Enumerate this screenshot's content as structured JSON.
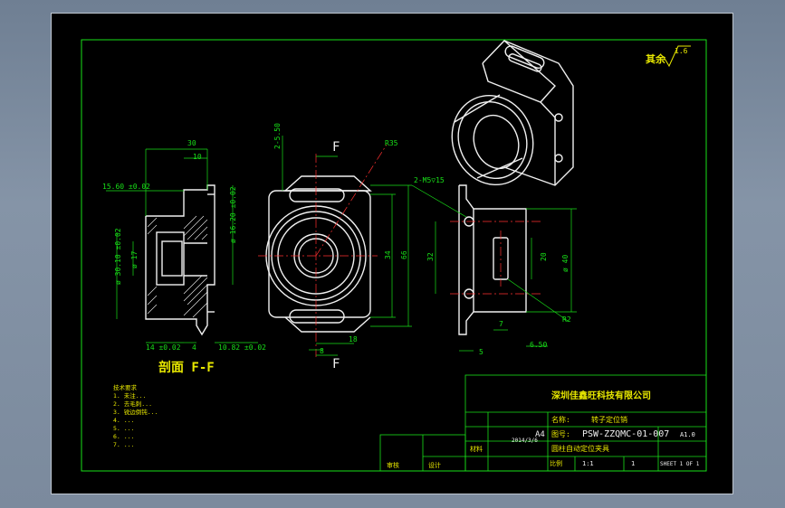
{
  "dimensions": {
    "d30": "30",
    "d10": "10",
    "d5_60": "15.60 ±0.02",
    "d16_20": "ø 16.20 ±0.02",
    "d30_10": "ø 30.10 ±0.02",
    "d17": "ø 17",
    "d14": "14 ±0.02",
    "d4": "4",
    "d10_82": "10.82 ±0.02",
    "d2_5_50": "2-5.50",
    "r35": "R35",
    "d34": "34",
    "d66": "66",
    "d18": "18",
    "d8": "8",
    "d2_m5": "2-M5▽15",
    "d32": "32",
    "d20": "20",
    "d40": "ø 40",
    "r2": "R2",
    "d7": "7",
    "d5": "5",
    "d6_50": "6.50",
    "section_f_top": "F",
    "section_f_bottom": "F"
  },
  "section_label": "剖面 F-F",
  "roughness": {
    "label": "其余",
    "value": "1.6"
  },
  "notes": [
    "技术要求",
    "1. 未注...",
    "2. 去毛刺...",
    "3. 锐边倒钝...",
    "4. ...",
    "5. ...",
    "6. ...",
    "7. ..."
  ],
  "title_block": {
    "company": "深圳佳鑫旺科技有限公司",
    "part_name_label": "名称:",
    "part_name": "转子定位销",
    "drawing_no_label": "图号:",
    "drawing_no": "PSW-ZZQMC-01-007",
    "size": "A4",
    "version": "A1.0",
    "material_label": "材料",
    "scale_label": "比例",
    "scale": "1:1",
    "qty": "1",
    "sheet": "SHEET 1 OF 1",
    "date": "2014/3/6",
    "product_name": "圆柱自动定位夹具",
    "designer_label": "设计",
    "checker_label": "审核"
  },
  "colors": {
    "frame": "#18e018",
    "part": "#f0f0f0",
    "dim": "#18e018",
    "center": "#ff3030",
    "text": "#e8e800"
  }
}
